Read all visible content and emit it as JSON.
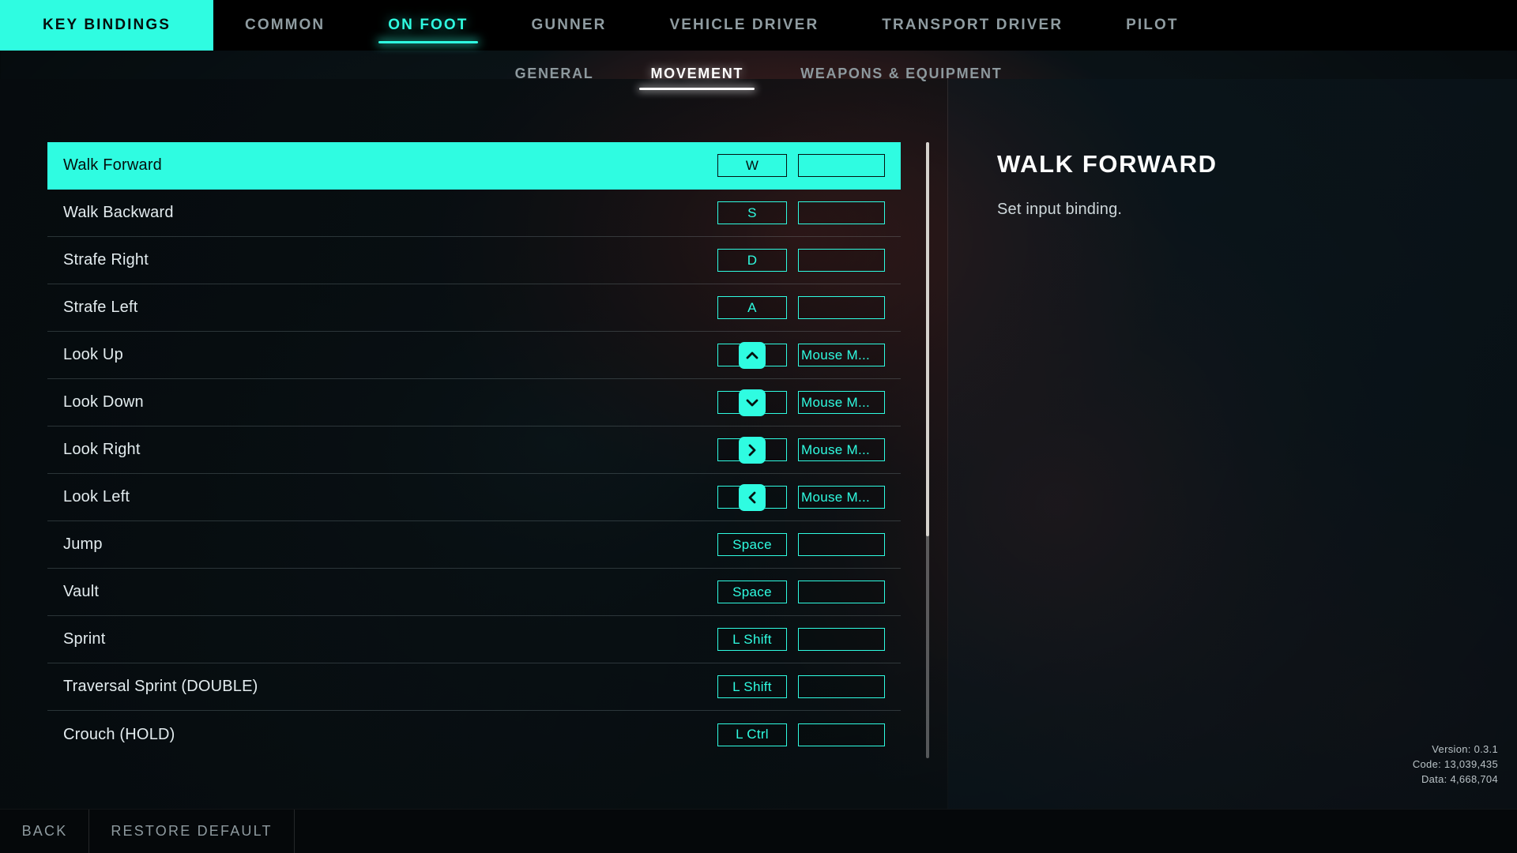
{
  "topbar": {
    "brand": "KEY BINDINGS",
    "tabs": [
      {
        "label": "COMMON",
        "active": false
      },
      {
        "label": "ON FOOT",
        "active": true
      },
      {
        "label": "GUNNER",
        "active": false
      },
      {
        "label": "VEHICLE DRIVER",
        "active": false
      },
      {
        "label": "TRANSPORT DRIVER",
        "active": false
      },
      {
        "label": "PILOT",
        "active": false
      }
    ]
  },
  "subtabs": [
    {
      "label": "GENERAL",
      "active": false
    },
    {
      "label": "MOVEMENT",
      "active": true
    },
    {
      "label": "WEAPONS & EQUIPMENT",
      "active": false
    }
  ],
  "bindings": [
    {
      "action": "Walk Forward",
      "primary": "W",
      "secondary": "",
      "icon": "",
      "selected": true
    },
    {
      "action": "Walk Backward",
      "primary": "S",
      "secondary": "",
      "icon": "",
      "selected": false
    },
    {
      "action": "Strafe Right",
      "primary": "D",
      "secondary": "",
      "icon": "",
      "selected": false
    },
    {
      "action": "Strafe Left",
      "primary": "A",
      "secondary": "",
      "icon": "",
      "selected": false
    },
    {
      "action": "Look Up",
      "primary": "",
      "secondary": "Mouse M...",
      "icon": "up",
      "selected": false
    },
    {
      "action": "Look Down",
      "primary": "",
      "secondary": "Mouse M...",
      "icon": "down",
      "selected": false
    },
    {
      "action": "Look Right",
      "primary": "",
      "secondary": "Mouse M...",
      "icon": "right",
      "selected": false
    },
    {
      "action": "Look Left",
      "primary": "",
      "secondary": "Mouse M...",
      "icon": "left",
      "selected": false
    },
    {
      "action": "Jump",
      "primary": "Space",
      "secondary": "",
      "icon": "",
      "selected": false
    },
    {
      "action": "Vault",
      "primary": "Space",
      "secondary": "",
      "icon": "",
      "selected": false
    },
    {
      "action": "Sprint",
      "primary": "L Shift",
      "secondary": "",
      "icon": "",
      "selected": false
    },
    {
      "action": "Traversal Sprint (DOUBLE)",
      "primary": "L Shift",
      "secondary": "",
      "icon": "",
      "selected": false
    },
    {
      "action": "Crouch (HOLD)",
      "primary": "L Ctrl",
      "secondary": "",
      "icon": "",
      "selected": false
    }
  ],
  "detail": {
    "title": "WALK FORWARD",
    "description": "Set input binding."
  },
  "version": {
    "version": "Version: 0.3.1",
    "code": "Code: 13,039,435",
    "data": "Data: 4,668,704"
  },
  "bottom": {
    "back": "BACK",
    "restore": "RESTORE DEFAULT"
  },
  "colors": {
    "accent": "#2ffce1",
    "accent_text_dark": "#05100e",
    "row_text": "#e3ecef",
    "muted": "#8e9a9f",
    "scrollbar_thumb": "#d6d2cd"
  },
  "scroll": {
    "thumb_ratio": 0.64
  }
}
